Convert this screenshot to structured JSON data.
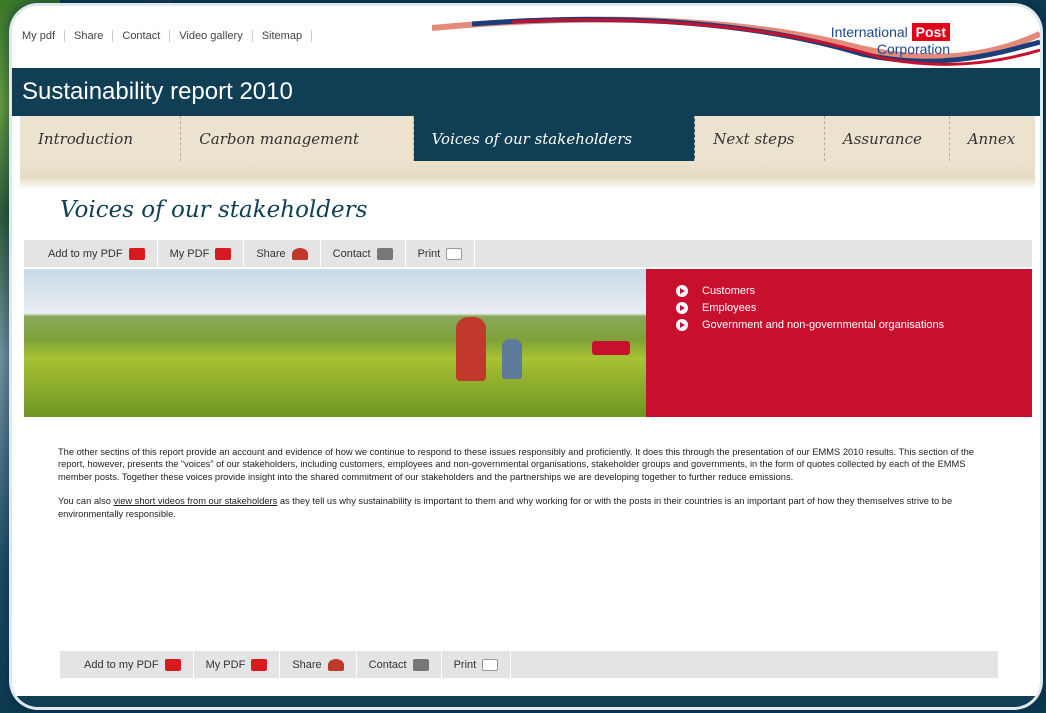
{
  "top_links": [
    "My pdf",
    "Share",
    "Contact",
    "Video gallery",
    "Sitemap"
  ],
  "logo": {
    "line1_a": "International",
    "line1_b": "Post",
    "line2": "Corporation"
  },
  "site_title": "Sustainability report 2010",
  "nav": [
    "Introduction",
    "Carbon management",
    "Voices of our stakeholders",
    "Next steps",
    "Assurance",
    "Annex"
  ],
  "nav_active": "Voices of our stakeholders",
  "page_title": "Voices of our stakeholders",
  "toolbar": {
    "add_pdf": "Add to my PDF",
    "my_pdf": "My PDF",
    "share": "Share",
    "contact": "Contact",
    "print": "Print"
  },
  "toolbar_icons": [
    "pdf-icon",
    "pdf-icon",
    "share-icon",
    "contact-icon",
    "print-icon"
  ],
  "stakeholder_links": [
    "Customers",
    "Employees",
    "Government and non-governmental organisations"
  ],
  "body": {
    "p1": "The other sectins of this report provide an account and evidence of how we continue to respond to these issues responsibly and proficiently. It does this through the presentation of our EMMS 2010 results. This section of the report, however, presents the “voices” of our stakeholders, including customers, employees and non-governmental organisations, stakeholder groups and governments, in the form of quotes collected by each of the EMMS member posts. Together these voices provide insight into the shared commitment of our stakeholders and the partnerships we are developing together to further reduce emissions.",
    "p2_before": "You can also ",
    "p2_link": "view short videos from our stakeholders",
    "p2_after": " as they tell us why sustainability is important to them and why working for or with the posts in their countries is an important part of how they themselves strive to be environmentally responsible."
  },
  "colors": {
    "navy": "#0f3e55",
    "red": "#c8102e",
    "parchment": "#ebe3cf"
  }
}
